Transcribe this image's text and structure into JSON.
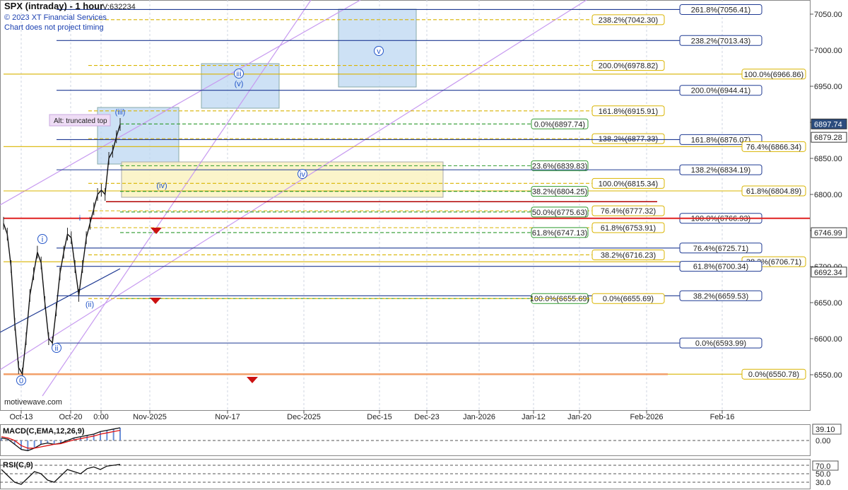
{
  "header": {
    "title": "SPX (intraday) - 1 hour",
    "volume": "V:632234",
    "copyright": "© 2023 XT Financial Services",
    "disclaimer": "Chart does not project timing"
  },
  "watermark": "motivewave.com",
  "colors": {
    "navy": "#1f3a93",
    "gold": "#d9b400",
    "green": "#2e9a2e",
    "red": "#e02020",
    "orange": "#f2a06a",
    "purple": "#b57edc",
    "box_blue": "#bcd7f2",
    "box_yellow": "#fbf3c4"
  },
  "chart_data": {
    "type": "line",
    "ylim": [
      6515,
      7060
    ],
    "y_ticks": [
      6550,
      6600,
      6650,
      6700,
      6750,
      6800,
      6850,
      6900,
      6950,
      7000,
      7050
    ],
    "y_tick_labels": [
      "6550.00",
      "6600.00",
      "6650.00",
      "6700.00",
      "6750.00",
      "6800.00",
      "6850.00",
      "6900.00",
      "6950.00",
      "7000.00",
      "7050.00"
    ],
    "x_labels": [
      "Oct-13",
      "Oct-20",
      "0:00",
      "Nov-2025",
      "Nov-17",
      "Dec-2025",
      "Dec-15",
      "Dec-23",
      "Jan-2026",
      "Jan-12",
      "Jan-20",
      "Feb-2026",
      "Feb-16"
    ],
    "price_badges": [
      {
        "text": "6897.74",
        "value": 6897.74,
        "style": "dark"
      },
      {
        "text": "6879.28",
        "value": 6879.28,
        "style": "light"
      },
      {
        "text": "6746.99",
        "value": 6746.99,
        "style": "light"
      },
      {
        "text": "6692.34",
        "value": 6692.34,
        "style": "light"
      }
    ],
    "fib_levels": [
      {
        "value": 7056.41,
        "text": "261.8%(7056.41)",
        "color": "navy",
        "style": "solid",
        "label_at": "right"
      },
      {
        "value": 7042.3,
        "text": "238.2%(7042.30)",
        "color": "gold",
        "style": "dashed",
        "label_at": "mid"
      },
      {
        "value": 7013.43,
        "text": "238.2%(7013.43)",
        "color": "navy",
        "style": "solid",
        "label_at": "right"
      },
      {
        "value": 6978.82,
        "text": "200.0%(6978.82)",
        "color": "gold",
        "style": "dashed",
        "label_at": "mid"
      },
      {
        "value": 6966.86,
        "text": "100.0%(6966.86)",
        "color": "gold",
        "style": "solid",
        "label_at": "far"
      },
      {
        "value": 6944.41,
        "text": "200.0%(6944.41)",
        "color": "navy",
        "style": "solid",
        "label_at": "right"
      },
      {
        "value": 6915.91,
        "text": "161.8%(6915.91)",
        "color": "gold",
        "style": "dashed",
        "label_at": "mid"
      },
      {
        "value": 6897.74,
        "text": "0.0%(6897.74)",
        "color": "green",
        "style": "dashed",
        "label_at": "green"
      },
      {
        "value": 6877.33,
        "text": "138.2%(6877.33)",
        "color": "gold",
        "style": "dashed",
        "label_at": "mid"
      },
      {
        "value": 6876.07,
        "text": "161.8%(6876.07)",
        "color": "navy",
        "style": "solid",
        "label_at": "right"
      },
      {
        "value": 6866.34,
        "text": "76.4%(6866.34)",
        "color": "gold",
        "style": "solid",
        "label_at": "far"
      },
      {
        "value": 6839.83,
        "text": "23.6%(6839.83)",
        "color": "green",
        "style": "dashed",
        "label_at": "green"
      },
      {
        "value": 6834.19,
        "text": "138.2%(6834.19)",
        "color": "navy",
        "style": "solid",
        "label_at": "right"
      },
      {
        "value": 6815.34,
        "text": "100.0%(6815.34)",
        "color": "gold",
        "style": "dashed",
        "label_at": "mid"
      },
      {
        "value": 6804.89,
        "text": "61.8%(6804.89)",
        "color": "gold",
        "style": "solid",
        "label_at": "far"
      },
      {
        "value": 6804.25,
        "text": "38.2%(6804.25)",
        "color": "green",
        "style": "dashed",
        "label_at": "green"
      },
      {
        "value": 6777.32,
        "text": "76.4%(6777.32)",
        "color": "gold",
        "style": "dashed",
        "label_at": "mid"
      },
      {
        "value": 6775.63,
        "text": "50.0%(6775.63)",
        "color": "green",
        "style": "dashed",
        "label_at": "green"
      },
      {
        "value": 6766.93,
        "text": "100.0%(6766.93)",
        "color": "navy",
        "style": "solid",
        "label_at": "right"
      },
      {
        "value": 6753.91,
        "text": "61.8%(6753.91)",
        "color": "gold",
        "style": "dashed",
        "label_at": "mid"
      },
      {
        "value": 6747.13,
        "text": "61.8%(6747.13)",
        "color": "green",
        "style": "dashed",
        "label_at": "green"
      },
      {
        "value": 6725.71,
        "text": "76.4%(6725.71)",
        "color": "navy",
        "style": "solid",
        "label_at": "right"
      },
      {
        "value": 6716.23,
        "text": "38.2%(6716.23)",
        "color": "gold",
        "style": "dashed",
        "label_at": "mid"
      },
      {
        "value": 6706.71,
        "text": "38.2%(6706.71)",
        "color": "gold",
        "style": "solid",
        "label_at": "far"
      },
      {
        "value": 6700.34,
        "text": "61.8%(6700.34)",
        "color": "navy",
        "style": "solid",
        "label_at": "right"
      },
      {
        "value": 6659.53,
        "text": "38.2%(6659.53)",
        "color": "navy",
        "style": "solid",
        "label_at": "right"
      },
      {
        "value": 6655.69,
        "text": "100.0%(6655.69)",
        "color": "green",
        "style": "dashed",
        "label_at": "green"
      },
      {
        "value": 6655.69,
        "text": "0.0%(6655.69)",
        "color": "gold",
        "style": "dashed",
        "label_at": "mid"
      },
      {
        "value": 6593.99,
        "text": "0.0%(6593.99)",
        "color": "navy",
        "style": "solid",
        "label_at": "right"
      },
      {
        "value": 6550.78,
        "text": "0.0%(6550.78)",
        "color": "gold",
        "style": "solid",
        "label_at": "far"
      }
    ],
    "wave_labels": [
      {
        "text": "0",
        "circled": true
      },
      {
        "text": "i",
        "circled": true
      },
      {
        "text": "ii",
        "circled": true
      },
      {
        "text": "i",
        "circled": false
      },
      {
        "text": "(ii)",
        "circled": false
      },
      {
        "text": "(iii)",
        "circled": false
      },
      {
        "text": "(iv)",
        "circled": false
      },
      {
        "text": "iii",
        "circled": true
      },
      {
        "text": "(v)",
        "circled": false
      },
      {
        "text": "iv",
        "circled": true
      },
      {
        "text": "v",
        "circled": true
      }
    ],
    "annotation": "Alt: truncated top",
    "price_path": [
      6760,
      6745,
      6700,
      6620,
      6560,
      6551,
      6600,
      6660,
      6690,
      6720,
      6705,
      6650,
      6600,
      6594,
      6640,
      6690,
      6720,
      6745,
      6740,
      6700,
      6660,
      6700,
      6740,
      6760,
      6780,
      6800,
      6806,
      6800,
      6850,
      6860,
      6880,
      6897
    ],
    "macd": {
      "label": "MACD(C,EMA,12,26,9)",
      "value_label": "39.10",
      "zero_label": "0.00",
      "macd_line": [
        0.2,
        0.1,
        -0.3,
        -0.7,
        -0.8,
        -0.6,
        -0.3,
        -0.2,
        -0.3,
        -0.2,
        0.0,
        0.2,
        0.3,
        0.4,
        0.5,
        0.7,
        0.8,
        0.9,
        1.0
      ],
      "signal_line": [
        0.3,
        0.2,
        0.0,
        -0.4,
        -0.6,
        -0.6,
        -0.5,
        -0.4,
        -0.3,
        -0.25,
        -0.1,
        0.05,
        0.15,
        0.25,
        0.35,
        0.5,
        0.6,
        0.7,
        0.8
      ]
    },
    "rsi": {
      "label": "RSI(C,9)",
      "ticks": [
        "70.0",
        "50.0",
        "30.0"
      ],
      "line": [
        60,
        45,
        30,
        25,
        40,
        55,
        50,
        35,
        30,
        45,
        60,
        55,
        50,
        62,
        66,
        60,
        68,
        70,
        72
      ]
    }
  }
}
